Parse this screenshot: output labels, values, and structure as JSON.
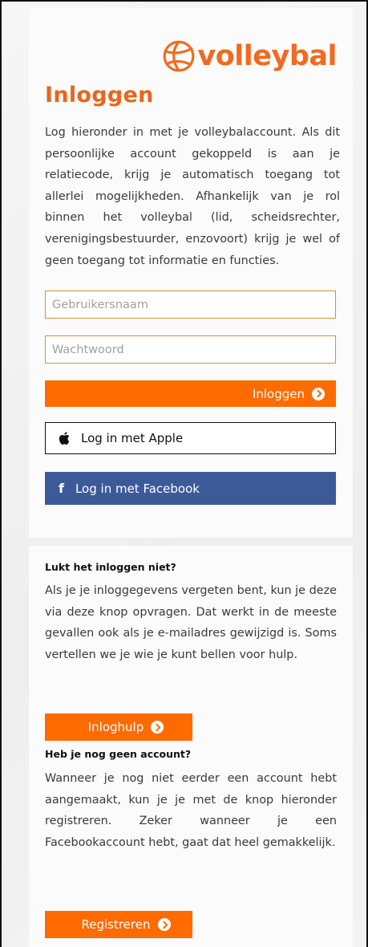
{
  "brand": {
    "logo_text": "volleybal",
    "accent": "#ff6b00",
    "title_color": "#e8661c"
  },
  "login": {
    "title": "Inloggen",
    "intro": "Log hieronder in met je volleybalaccount. Als dit persoonlijke account gekoppeld is aan je relatiecode, krijg je automatisch toegang tot allerlei mogelijkheden. Afhankelijk van je rol binnen het volleybal (lid, scheidsrechter, verenigingsbestuurder, enzovoort) krijg je wel of geen toegang tot informatie en functies.",
    "username_placeholder": "Gebruikersnaam",
    "password_placeholder": "Wachtwoord",
    "submit_label": "Inloggen",
    "apple_label": "Log in met Apple",
    "facebook_label": "Log in met Facebook",
    "facebook_color": "#3d5a98"
  },
  "help": {
    "title": "Lukt het inloggen niet?",
    "text": "Als je je inloggegevens vergeten bent, kun je deze via deze knop opvragen. Dat werkt in de meeste gevallen ook als je e-mailadres gewijzigd is. Soms vertellen we je wie je kunt bellen voor hulp.",
    "button_label": "Inloghulp"
  },
  "register": {
    "title": "Heb je nog geen account?",
    "text": "Wanneer je nog niet eerder een account hebt aangemaakt, kun je je met de knop hieronder registreren. Zeker wanneer je een Facebookaccount hebt, gaat dat heel gemakkelijk.",
    "button_label": "Registreren"
  }
}
